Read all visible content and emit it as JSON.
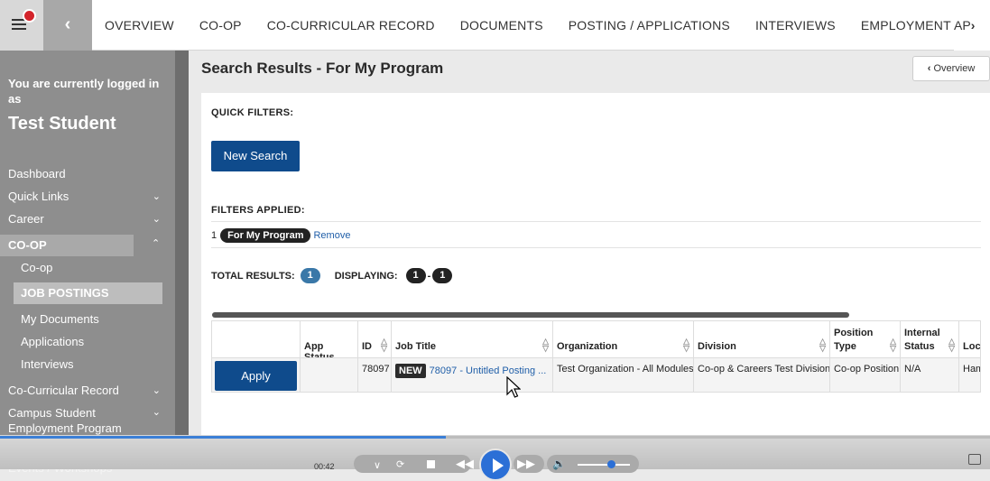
{
  "topbar": {
    "tabs": [
      "OVERVIEW",
      "CO-OP",
      "CO-CURRICULAR RECORD",
      "DOCUMENTS",
      "POSTING / APPLICATIONS",
      "INTERVIEWS",
      "EMPLOYMENT OFFERS"
    ],
    "more_tab": "AP"
  },
  "sidebar": {
    "login_msg": "You are currently logged in as",
    "user_name": "Test Student",
    "items": [
      "Dashboard",
      "Quick Links",
      "Career",
      "CO-OP"
    ],
    "coop_sub": [
      "Co-op",
      "JOB POSTINGS",
      "My Documents",
      "Applications",
      "Interviews"
    ],
    "bottom_items": [
      "Co-Curricular Record",
      "Campus Student Employment Program (CSEP)",
      "Events / Workshops"
    ]
  },
  "main": {
    "title": "Search Results - For My Program",
    "overview_btn": "Overview",
    "quick_filters_label": "QUICK FILTERS:",
    "new_search": "New Search",
    "filters_applied_label": "FILTERS APPLIED:",
    "filter_count": "1",
    "filter_pill": "For My Program",
    "remove": "Remove",
    "total_results_label": "TOTAL RESULTS:",
    "total_results": "1",
    "displaying_label": "DISPLAYING:",
    "display_from": "1",
    "display_sep": "-",
    "display_to": "1"
  },
  "table": {
    "headers": [
      "App Status",
      "ID",
      "Job Title",
      "Organization",
      "Division",
      "Position Type",
      "Internal Status",
      "Loca"
    ],
    "row": {
      "apply": "Apply",
      "app_status": "",
      "id": "78097",
      "new_badge": "NEW",
      "job_title": "78097 - Untitled Posting ...",
      "organization": "Test Organization - All Modules",
      "division": "Co-op & Careers Test Division",
      "position_type": "Co-op Position",
      "internal_status": "N/A",
      "location": "Ham"
    }
  },
  "player": {
    "time": "00:42",
    "progress": 0.45
  },
  "colors": {
    "primary": "#0f4b8c",
    "link": "#1f5ea8",
    "sidebar": "#8e8e8e"
  }
}
